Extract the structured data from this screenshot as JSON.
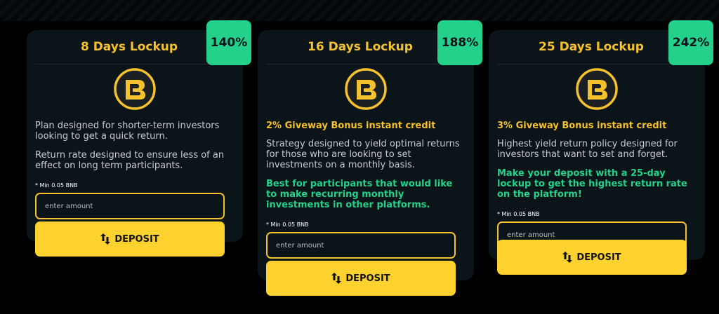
{
  "plans": [
    {
      "title": "8 Days Lockup",
      "rate": "140%",
      "bonus": "",
      "desc1": "Plan designed for shorter-term investors looking to get a quick return.",
      "desc2": "Return rate designed to ensure less of an effect on long term participants.",
      "highlight": "",
      "min_label": "* Min 0.05 BNB",
      "placeholder": "enter amount",
      "button": "DEPOSIT"
    },
    {
      "title": "16 Days Lockup",
      "rate": "188%",
      "bonus": "2% Giveway Bonus instant credit",
      "desc1": "Strategy designed to yield optimal returns for those who are looking to set investments on a monthly basis.",
      "desc2": "",
      "highlight": "Best for participants that would like to make recurring monthly investments in other platforms.",
      "min_label": "* Min 0.05 BNB",
      "placeholder": "enter amount",
      "button": "DEPOSIT"
    },
    {
      "title": "25 Days Lockup",
      "rate": "242%",
      "bonus": "3% Giveway Bonus instant credit",
      "desc1": "Highest yield return policy designed for investors that want to set and forget.",
      "desc2": "",
      "highlight": "Make your deposit with a 25-day lockup to get the highest return rate on the platform!",
      "min_label": "* Min 0.05 BNB",
      "placeholder": "enter amount",
      "button": "DEPOSIT"
    }
  ],
  "colors": {
    "accent": "#f5c12d",
    "button": "#fdd22e",
    "badge": "#23d18a",
    "card": "#0b1419"
  },
  "icons": {
    "logo": "rb-coin-logo",
    "deposit": "swap-arrows-icon"
  }
}
